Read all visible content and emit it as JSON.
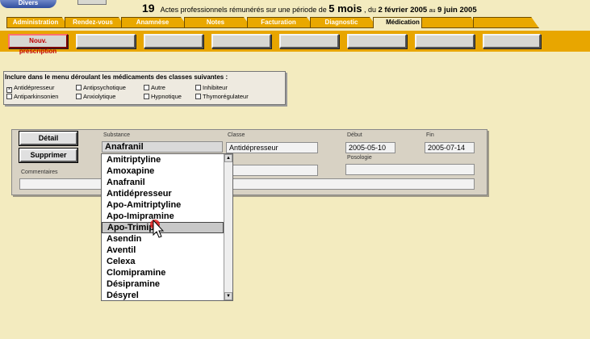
{
  "header": {
    "left_button_label": "Divers",
    "pro_count": "19",
    "text_before_period": "Actes professionnels rémunérés sur une période de",
    "period_value": "5 mois",
    "comma_du": ", du",
    "start_date": "2 février 2005",
    "au": "au",
    "end_date": "9 juin 2005"
  },
  "tabs": [
    "Administration",
    "Rendez-vous",
    "Anamnèse",
    "Notes",
    "Facturation",
    "Diagnostic",
    "Médication"
  ],
  "active_tab": "Médication",
  "toolbar": {
    "new_prescription_label": "Nouv. prescription"
  },
  "filter": {
    "title": "Inclure dans le menu déroulant les  médicaments des classes suivantes :",
    "checkboxes": [
      {
        "label": "Antidépresseur",
        "checked": true
      },
      {
        "label": "Antipsychotique",
        "checked": false
      },
      {
        "label": "Autre",
        "checked": false
      },
      {
        "label": "Inhibiteur",
        "checked": false
      },
      {
        "label": "Antiparkinsonien",
        "checked": false
      },
      {
        "label": "Anxiolytique",
        "checked": false
      },
      {
        "label": "Hypnotique",
        "checked": false
      },
      {
        "label": "Thymorégulateur",
        "checked": false
      }
    ]
  },
  "medication": {
    "detail_button": "Détail",
    "delete_button": "Supprimer",
    "substance_label": "Substance",
    "substance_value": "Anafranil",
    "classe_label": "Classe",
    "classe_value": "Antidépresseur",
    "debut_label": "Début",
    "debut_value": "2005-05-10",
    "fin_label": "Fin",
    "fin_value": "2005-07-14",
    "posologie_label": "Posologie",
    "posologie_value": "",
    "commentaires_label": "Commentaires"
  },
  "dropdown": {
    "items": [
      "Amitriptyline",
      "Amoxapine",
      "Anafranil",
      "Antidépresseur",
      "Apo-Amitriptyline",
      "Apo-Imipramine",
      "Apo-Trimip",
      "Asendin",
      "Aventil",
      "Celexa",
      "Clomipramine",
      "Désipramine",
      "Désyrel"
    ],
    "highlighted_index": 6
  }
}
